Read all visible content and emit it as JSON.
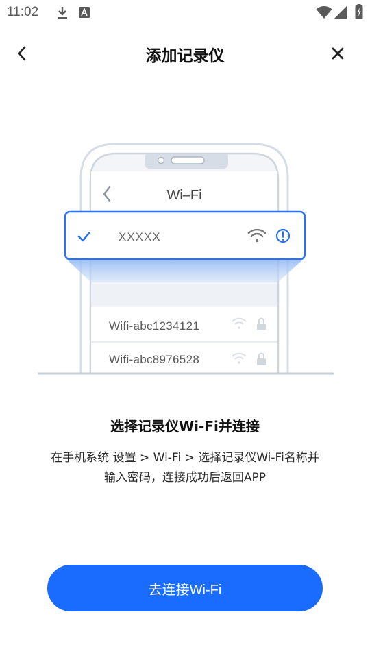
{
  "status_bar": {
    "time": "11:02",
    "icons": [
      "download-icon",
      "a-notification-icon",
      "wifi-icon",
      "signal-icon",
      "battery-charging-icon"
    ]
  },
  "header": {
    "title": "添加记录仪",
    "back_icon": "chevron-left-icon",
    "close_icon": "close-icon"
  },
  "illustration": {
    "phone_screen_title": "Wi–Fi",
    "selected_network": "XXXXX",
    "networks": [
      {
        "name": "Wifi-abc1234121"
      },
      {
        "name": "Wifi-abc8976528"
      }
    ]
  },
  "instruction": {
    "title": "选择记录仪Wi-Fi并连接",
    "body_line1": "在手机系统 设置 > Wi-Fi > 选择记录仪Wi-Fi名称并",
    "body_line2": "输入密码，连接成功后返回APP"
  },
  "connect_button": {
    "label": "去连接Wi-Fi"
  },
  "colors": {
    "accent": "#1a6bff",
    "highlight_border": "#2b72f0"
  }
}
